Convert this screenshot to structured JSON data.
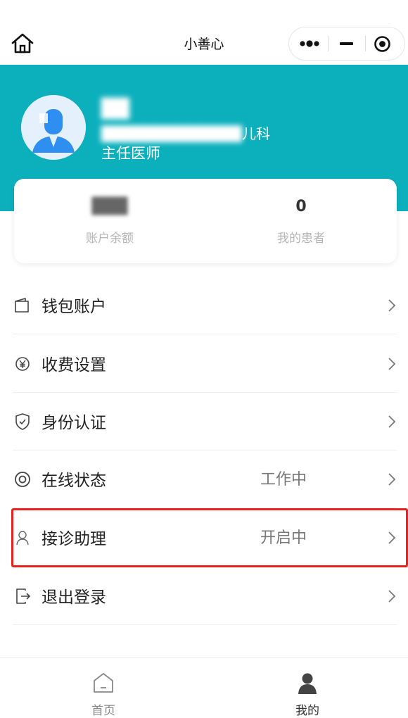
{
  "nav": {
    "title": "小善心"
  },
  "profile": {
    "name": "██",
    "hospital_hidden": "█████████████",
    "hospital_suffix": "儿科",
    "title": "主任医师"
  },
  "stats": {
    "balance": {
      "value": "███",
      "label": "账户余额"
    },
    "patients": {
      "value": "0",
      "label": "我的患者"
    }
  },
  "menu": {
    "items": [
      {
        "label": "钱包账户",
        "value": "",
        "icon": "wallet-icon"
      },
      {
        "label": "收费设置",
        "value": "",
        "icon": "yen-icon"
      },
      {
        "label": "身份认证",
        "value": "",
        "icon": "shield-check-icon"
      },
      {
        "label": "在线状态",
        "value": "工作中",
        "icon": "online-status-icon"
      },
      {
        "label": "接诊助理",
        "value": "开启中",
        "icon": "person-icon"
      },
      {
        "label": "退出登录",
        "value": "",
        "icon": "logout-icon"
      }
    ]
  },
  "tabbar": {
    "items": [
      {
        "label": "首页",
        "icon": "home-tab-icon"
      },
      {
        "label": "我的",
        "icon": "user-tab-icon"
      }
    ]
  },
  "colors": {
    "accent": "#0cb0bd",
    "highlight": "#e8221f",
    "tab_active": "#333333",
    "tab_inactive": "#888888"
  }
}
